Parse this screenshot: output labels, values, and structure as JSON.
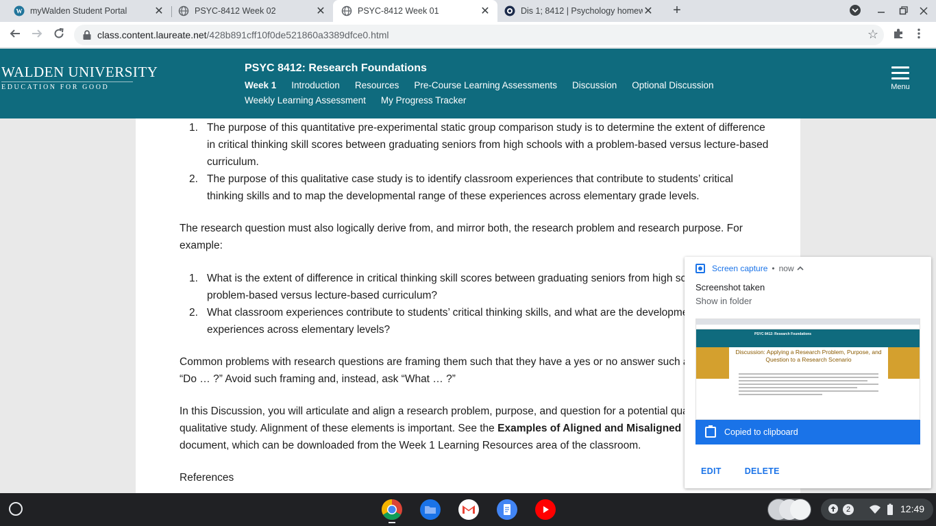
{
  "browser": {
    "tabs": [
      {
        "title": "myWalden Student Portal",
        "close": "✕"
      },
      {
        "title": "PSYC-8412 Week 02",
        "close": "✕"
      },
      {
        "title": "PSYC-8412 Week 01",
        "close": "✕"
      },
      {
        "title": "Dis 1; 8412 | Psychology homew",
        "close": "✕"
      }
    ],
    "new_tab": "+",
    "url_domain": "class.content.laureate.net",
    "url_path": "/428b891cff10f0de521860a3389dfce0.html"
  },
  "site": {
    "logo_line1": "WALDEN UNIVERSITY",
    "logo_line2": "EDUCATION FOR GOOD",
    "course_title": "PSYC 8412: Research Foundations",
    "nav": [
      "Week 1",
      "Introduction",
      "Resources",
      "Pre-Course Learning Assessments",
      "Discussion",
      "Optional Discussion",
      "Weekly Learning Assessment",
      "My Progress Tracker"
    ],
    "menu_label": "Menu"
  },
  "content": {
    "purpose_list": [
      {
        "num": "1.",
        "text": "The purpose of this quantitative pre-experimental static group comparison study is to determine the extent of difference in critical thinking skill scores between graduating seniors from high schools with a problem-based versus lecture-based curriculum."
      },
      {
        "num": "2.",
        "text": "The purpose of this qualitative case study is to identify classroom experiences that contribute to students’ critical thinking skills and to map the developmental range of these experiences across elementary grade levels."
      }
    ],
    "para1": "The research question must also logically derive from, and mirror both, the research problem and research purpose. For example:",
    "question_list": [
      {
        "num": "1.",
        "text": "What is the extent of difference in critical thinking skill scores between graduating seniors from high schools with a problem-based versus lecture-based curriculum?"
      },
      {
        "num": "2.",
        "text": "What classroom experiences contribute to students’ critical thinking skills, and what are the developmental range of experiences across elementary levels?"
      }
    ],
    "para2": "Common problems with research questions are framing them such that they have a yes or no answer such as “Does … ?” or “Do … ?” Avoid such framing and, instead, ask “What … ?”",
    "para3_a": "In this Discussion, you will articulate and align a research problem, purpose, and question for a potential quantitative and qualitative study. Alignment of these elements is important. See the ",
    "para3_bold": "Examples of Aligned and Misaligned Scenarios",
    "para3_b": " document, which can be downloaded from the Week 1 Learning Resources area of the classroom.",
    "references": "References"
  },
  "notification": {
    "source": "Screen capture",
    "time": "now",
    "title": "Screenshot taken",
    "subtitle": "Show in folder",
    "thumb_course": "PSYC 8412: Research Foundations",
    "thumb_title": "Discussion: Applying a Research Problem, Purpose, and Question to a Research Scenario",
    "copied": "Copied to clipboard",
    "edit": "EDIT",
    "delete": "DELETE"
  },
  "shelf": {
    "notification_count": "2",
    "clock": "12:49"
  }
}
